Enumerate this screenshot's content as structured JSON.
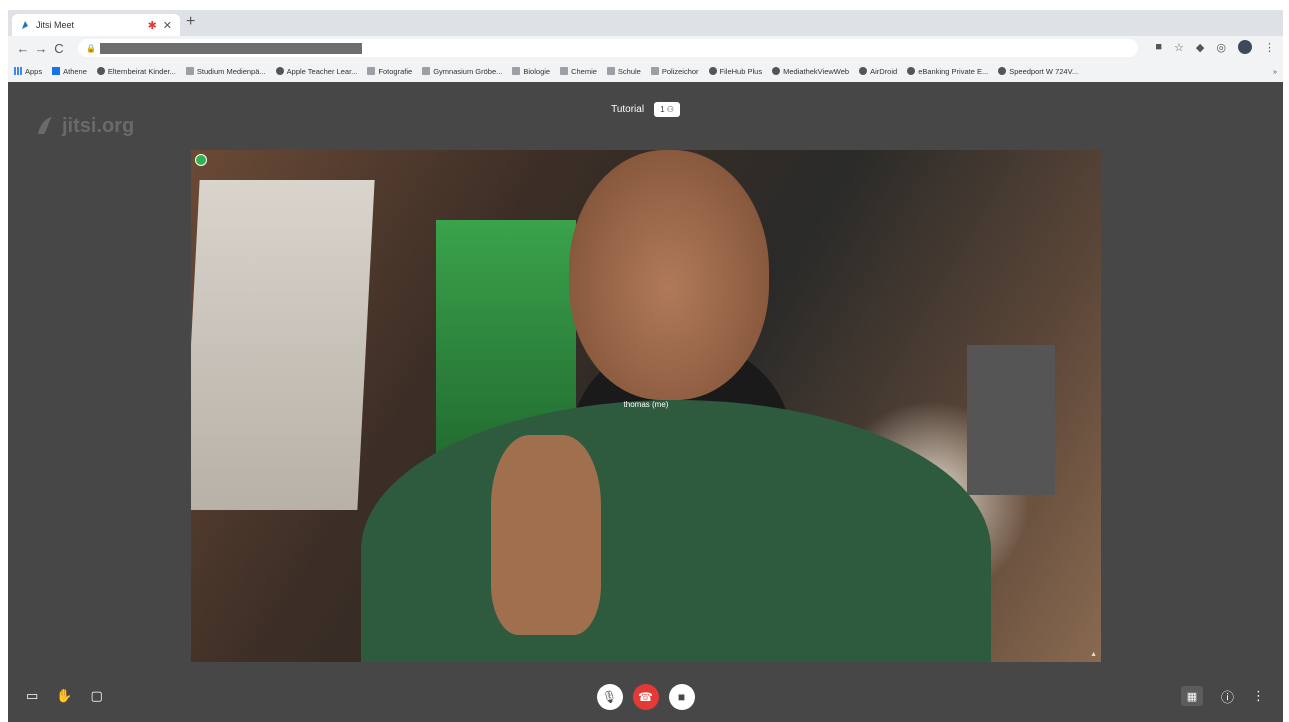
{
  "browser": {
    "tab": {
      "title": "Jitsi Meet",
      "close_icon": "✕"
    },
    "new_tab_icon": "+",
    "nav": {
      "back": "←",
      "forward": "→",
      "reload": "C"
    },
    "bookmarks": [
      {
        "label": "Apps",
        "icon": "apps-icon"
      },
      {
        "label": "Athene",
        "icon": "app-icon"
      },
      {
        "label": "Elternbeirat Kinder...",
        "icon": "globe-icon"
      },
      {
        "label": "Studium Medienpä...",
        "icon": "folder-icon"
      },
      {
        "label": "Apple Teacher Lear...",
        "icon": "globe-icon"
      },
      {
        "label": "Fotografie",
        "icon": "folder-icon"
      },
      {
        "label": "Gymnasium Gröbe...",
        "icon": "folder-icon"
      },
      {
        "label": "Biologie",
        "icon": "folder-icon"
      },
      {
        "label": "Chemie",
        "icon": "folder-icon"
      },
      {
        "label": "Schule",
        "icon": "folder-icon"
      },
      {
        "label": "Polizeichor",
        "icon": "folder-icon"
      },
      {
        "label": "FileHub Plus",
        "icon": "globe-icon"
      },
      {
        "label": "MediathekViewWeb",
        "icon": "globe-icon"
      },
      {
        "label": "AirDroid",
        "icon": "globe-icon"
      },
      {
        "label": "eBanking Private E...",
        "icon": "globe-icon"
      },
      {
        "label": "Speedport W 724V...",
        "icon": "globe-icon"
      }
    ],
    "bookmarks_more": "»"
  },
  "meeting": {
    "watermark": "jitsi.org",
    "title": "Tutorial",
    "participants_count": "1",
    "participant_display_name": "thomas (me)",
    "toolbar": {
      "left": [
        "screenshare-icon",
        "raise-hand-icon",
        "chat-icon"
      ],
      "center": [
        "microphone-icon",
        "hangup-icon",
        "camera-icon"
      ],
      "right": [
        "tile-view-icon",
        "info-icon",
        "more-icon"
      ]
    }
  },
  "colors": {
    "meeting_bg": "#474747",
    "hangup": "#e53935",
    "quality_good": "#31b24b"
  }
}
